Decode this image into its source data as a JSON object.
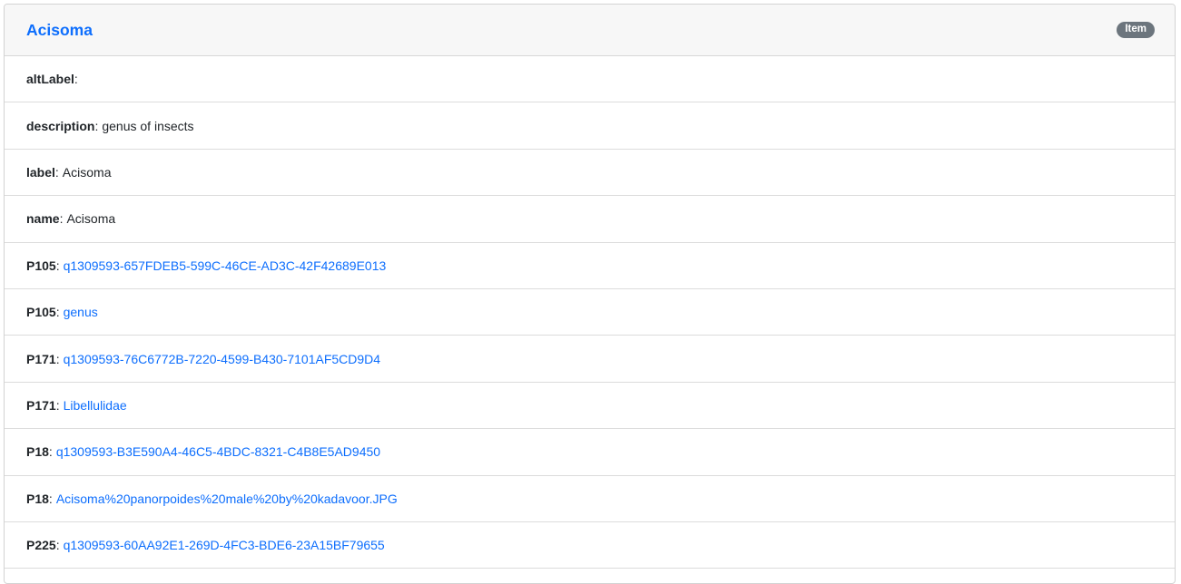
{
  "header": {
    "title": "Acisoma",
    "badge": "Item"
  },
  "rows": [
    {
      "key": "altLabel",
      "value": "",
      "is_link": false
    },
    {
      "key": "description",
      "value": "genus of insects",
      "is_link": false
    },
    {
      "key": "label",
      "value": "Acisoma",
      "is_link": false
    },
    {
      "key": "name",
      "value": "Acisoma",
      "is_link": false
    },
    {
      "key": "P105",
      "value": "q1309593-657FDEB5-599C-46CE-AD3C-42F42689E013",
      "is_link": true
    },
    {
      "key": "P105",
      "value": "genus",
      "is_link": true
    },
    {
      "key": "P171",
      "value": "q1309593-76C6772B-7220-4599-B430-7101AF5CD9D4",
      "is_link": true
    },
    {
      "key": "P171",
      "value": "Libellulidae",
      "is_link": true
    },
    {
      "key": "P18",
      "value": "q1309593-B3E590A4-46C5-4BDC-8321-C4B8E5AD9450",
      "is_link": true
    },
    {
      "key": "P18",
      "value": "Acisoma%20panorpoides%20male%20by%20kadavoor.JPG",
      "is_link": true
    },
    {
      "key": "P225",
      "value": "q1309593-60AA92E1-269D-4FC3-BDE6-23A15BF79655",
      "is_link": true
    }
  ],
  "separator": ":",
  "colors": {
    "link": "#0d6efd",
    "badge_bg": "#6c757d",
    "header_bg": "#f7f7f7"
  }
}
